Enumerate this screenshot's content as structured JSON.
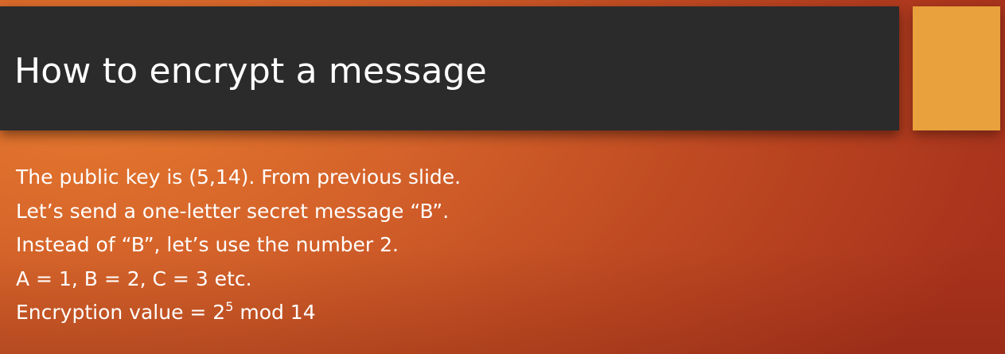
{
  "slide": {
    "title": "How to encrypt a message",
    "lines": [
      "The public key is (5,14). From previous slide.",
      "Let’s send a one-letter secret message “B”.",
      "Instead of “B”, let’s use the number 2.",
      "A = 1, B = 2, C = 3 etc."
    ],
    "encryption": {
      "prefix": "Encryption value = 2",
      "exponent": "5",
      "suffix": " mod 14"
    }
  },
  "colors": {
    "title_bar": "#2b2b2b",
    "accent_square": "#e8a13c",
    "background_light": "#e5782e",
    "background_dark": "#a8321c",
    "text": "#ffffff"
  }
}
